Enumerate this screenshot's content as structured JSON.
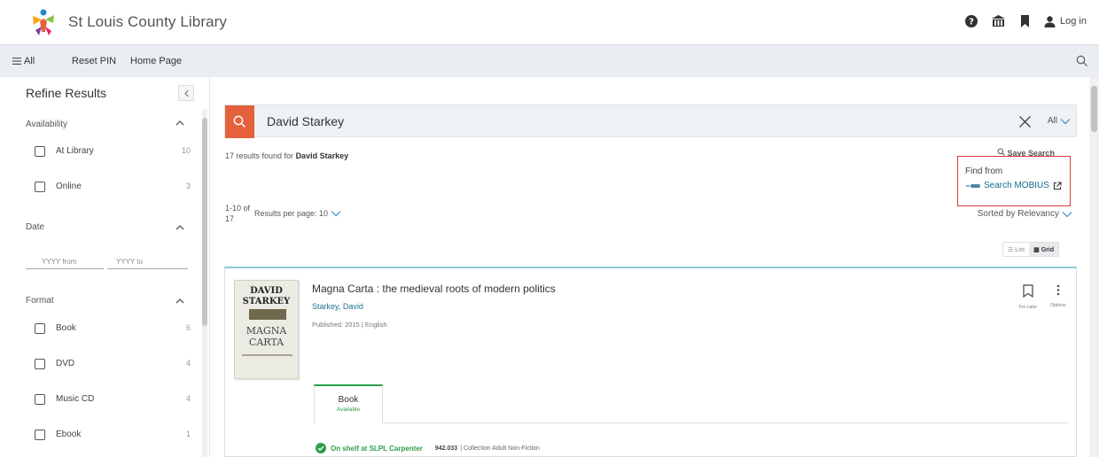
{
  "header": {
    "site_title": "St Louis County Library",
    "login_label": "Log in",
    "icons": [
      "help-icon",
      "library-icon",
      "bookmark-icon",
      "user-icon"
    ]
  },
  "nav": {
    "all_label": "All",
    "items": [
      "Reset PIN",
      "Home Page"
    ]
  },
  "sidebar": {
    "title": "Refine Results",
    "availability": {
      "heading": "Availability",
      "options": [
        {
          "label": "At Library",
          "count": "10"
        },
        {
          "label": "Online",
          "count": "3"
        }
      ]
    },
    "date": {
      "heading": "Date",
      "from_placeholder": "YYYY from",
      "to_placeholder": "YYYY to"
    },
    "format": {
      "heading": "Format",
      "options": [
        {
          "label": "Book",
          "count": "6"
        },
        {
          "label": "DVD",
          "count": "4"
        },
        {
          "label": "Music CD",
          "count": "4"
        },
        {
          "label": "Ebook",
          "count": "1"
        }
      ]
    }
  },
  "search": {
    "query": "David Starkey",
    "scope": "All"
  },
  "results": {
    "count_prefix": "17 results found for",
    "count_query": "David Starkey",
    "save_search": "Save Search",
    "find_from": "Find from",
    "find_link": "Search MOBIUS",
    "paging": "1-10 of 17",
    "per_page": "Results per page: 10",
    "sort": "Sorted by Relevancy",
    "view_list": "List",
    "view_grid": "Grid"
  },
  "item": {
    "title": "Magna Carta : the medieval roots of modern politics",
    "author": "Starkey, David",
    "published": "Published: 2015 | English",
    "cover_top": "DAVID STARKEY",
    "cover_bottom": "MAGNA CARTA",
    "for_later": "For Later",
    "options": "Options",
    "format_tab": "Book",
    "format_status": "Available",
    "availability": "On shelf at SLPL Carpenter",
    "call_number": "942.033",
    "collection": "| Collection Adult Non-Fiction"
  },
  "colors": {
    "accent": "#e5613c",
    "link": "#1b7592",
    "available": "#2e9d4a",
    "highlight_box": "#d43d3d"
  }
}
